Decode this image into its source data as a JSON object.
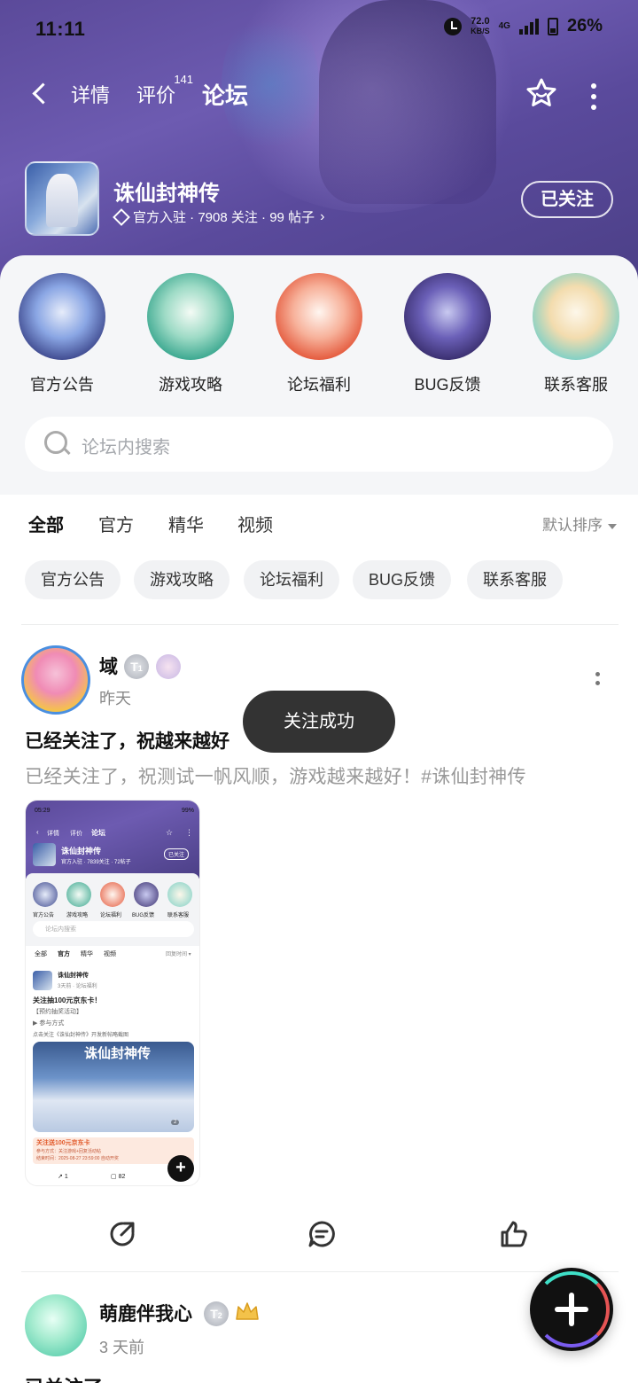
{
  "status": {
    "time": "11:11",
    "net_speed": "72.0",
    "net_unit": "KB/S",
    "network": "4G",
    "battery": "26%"
  },
  "nav": {
    "tabs": [
      "详情",
      "评价",
      "论坛"
    ],
    "review_count": "141",
    "active_tab": "论坛"
  },
  "game": {
    "title": "诛仙封神传",
    "meta": "官方入驻 · 7908 关注 · 99 帖子",
    "follow_label": "已关注"
  },
  "categories": [
    {
      "label": "官方公告",
      "icon": "official-announcement-art"
    },
    {
      "label": "游戏攻略",
      "icon": "game-guide-art"
    },
    {
      "label": "论坛福利",
      "icon": "forum-welfare-art"
    },
    {
      "label": "BUG反馈",
      "icon": "bug-feedback-art"
    },
    {
      "label": "联系客服",
      "icon": "contact-support-art"
    }
  ],
  "search": {
    "placeholder": "论坛内搜索"
  },
  "filters": {
    "tabs": [
      "全部",
      "官方",
      "精华",
      "视频"
    ],
    "active": "全部",
    "sort_label": "默认排序",
    "chips": [
      "官方公告",
      "游戏攻略",
      "论坛福利",
      "BUG反馈",
      "联系客服"
    ]
  },
  "post1": {
    "user": "域",
    "level": "1",
    "time": "昨天",
    "title": "已经关注了，祝越来越好",
    "body": "已经关注了，祝测试一帆风顺，游戏越来越好！#诛仙封神传",
    "thumb": {
      "time": "05:29",
      "battery": "99%",
      "tabs": [
        "详情",
        "评价",
        "论坛"
      ],
      "game_title": "诛仙封神传",
      "game_meta": "官方入驻 · 7839关注 · 72帖子",
      "follow_label": "已关注",
      "categories": [
        "官方公告",
        "游戏攻略",
        "论坛福利",
        "BUG反馈",
        "联系客服"
      ],
      "search": "论坛内搜索",
      "filter_tabs": [
        "全部",
        "官方",
        "精华",
        "视频"
      ],
      "sort": "回复时间 ▾",
      "author": "诛仙封神传",
      "author_meta": "3天前 · 论坛福利",
      "post_title": "关注抽100元京东卡！",
      "line1": "【预约抽奖活动】",
      "line2": "▶ 参与方式",
      "line3": "点击关注《诛仙封神传》开发新帖略截图",
      "banner_logo": "诛仙封神传",
      "img_count": "2",
      "banner_title": "关注送100元京东卡",
      "banner_sub": "参与方式：关注游戏+回复活动帖",
      "banner_time": "结束时间：2025-08-27 23:59:00 自动开奖",
      "share_count": "1",
      "comment_count": "82"
    }
  },
  "toast": "关注成功",
  "post2": {
    "user": "萌鹿伴我心",
    "level": "2",
    "time": "3 天前",
    "body_partial": "已关注了"
  },
  "colors": {
    "accent": "#4be3c7",
    "hero": "#5b4a9a",
    "toast": "#333333"
  }
}
